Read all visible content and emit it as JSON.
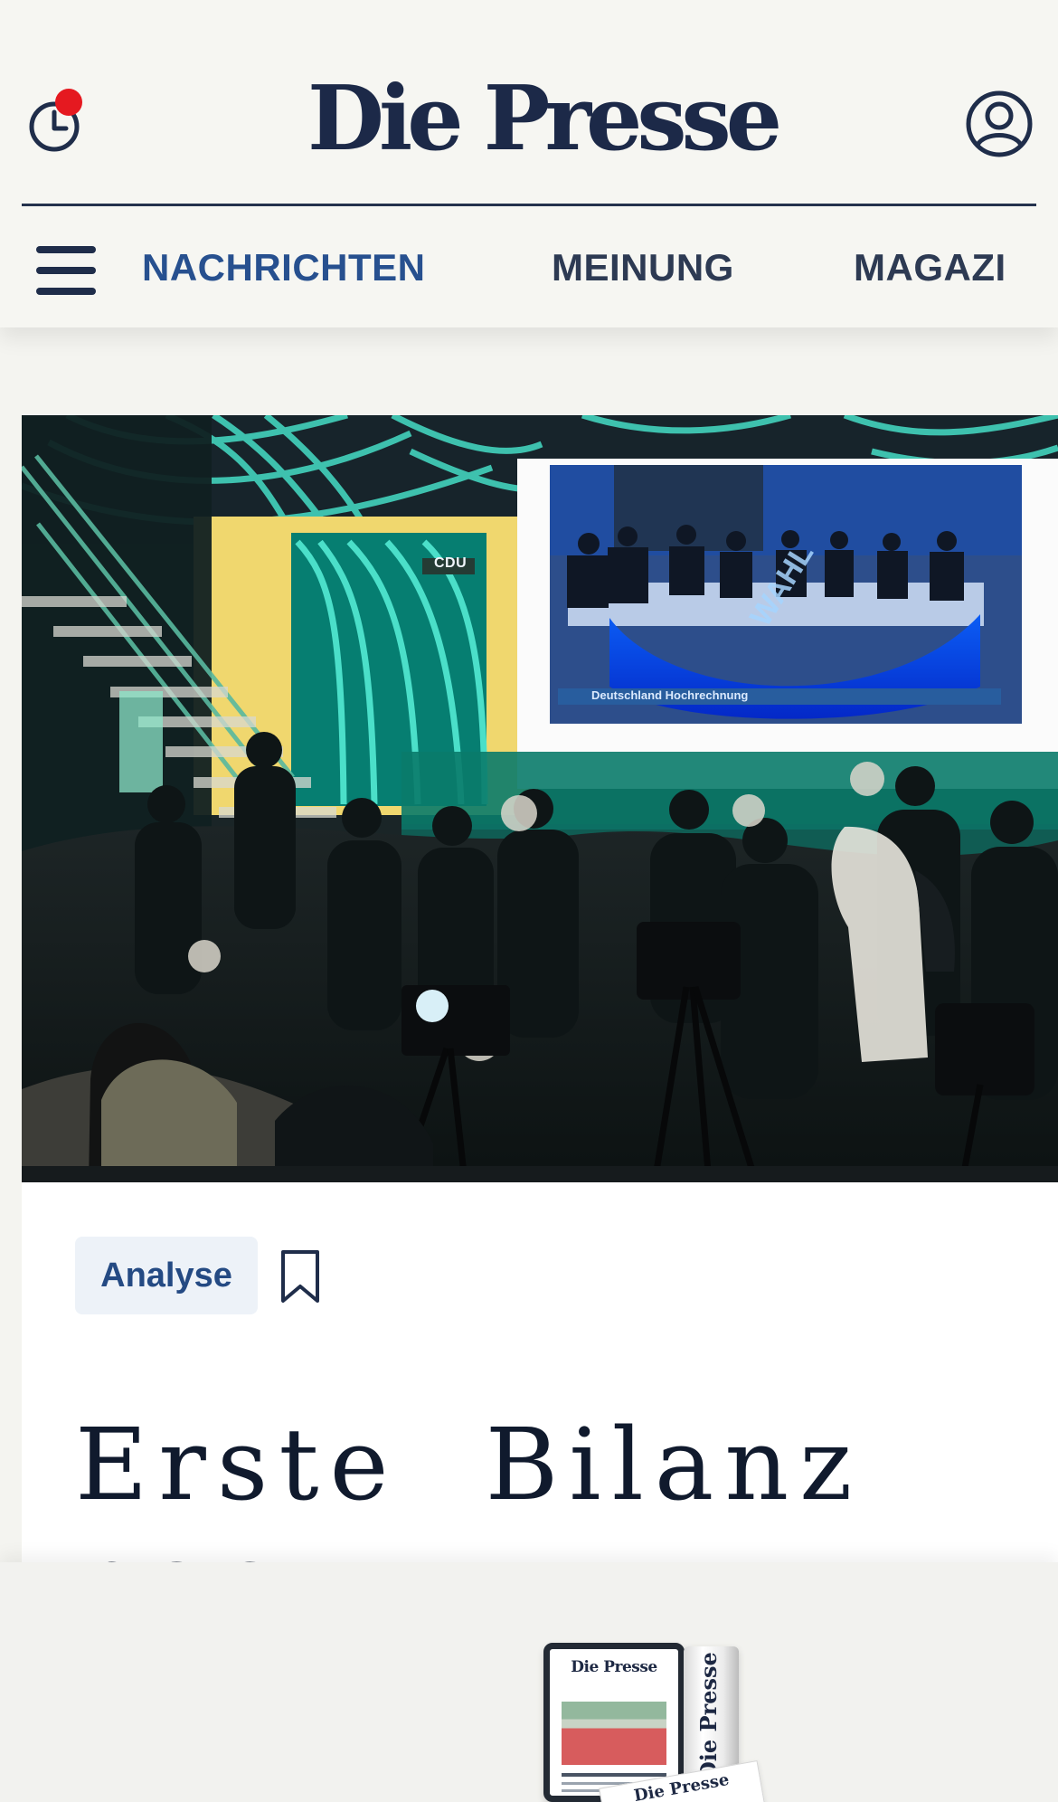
{
  "header": {
    "logo": "Die Presse",
    "history_icon": "clock-notification-icon",
    "account_icon": "user-icon"
  },
  "navigation": {
    "menu_icon": "hamburger-menu-icon",
    "items": [
      {
        "label": "NACHRICHTEN",
        "active": true
      },
      {
        "label": "MEINUNG",
        "active": false
      },
      {
        "label": "MAGAZI",
        "active": false
      }
    ]
  },
  "article": {
    "hero_image": {
      "subject": "election event with audience, cameras, and broadcast screen",
      "visible_text": {
        "sign": "CDU",
        "screen_caption": "Deutschland Hochrechnung",
        "screen_graphic": "WAHL"
      }
    },
    "tag": "Analyse",
    "bookmark_icon": "bookmark-icon",
    "headline": "Erste Bilanz nac\nDeutschland-Wah"
  },
  "bottom_promo": {
    "product_logo": "Die Presse",
    "product_items": [
      "tablet edition",
      "newspaper edition"
    ]
  },
  "colors": {
    "page_background": "#f4f4f0",
    "header_text": "#1f2d4a",
    "active_navigation": "#27508f",
    "notification": "#e51920",
    "tag_background": "#edf2f8"
  }
}
